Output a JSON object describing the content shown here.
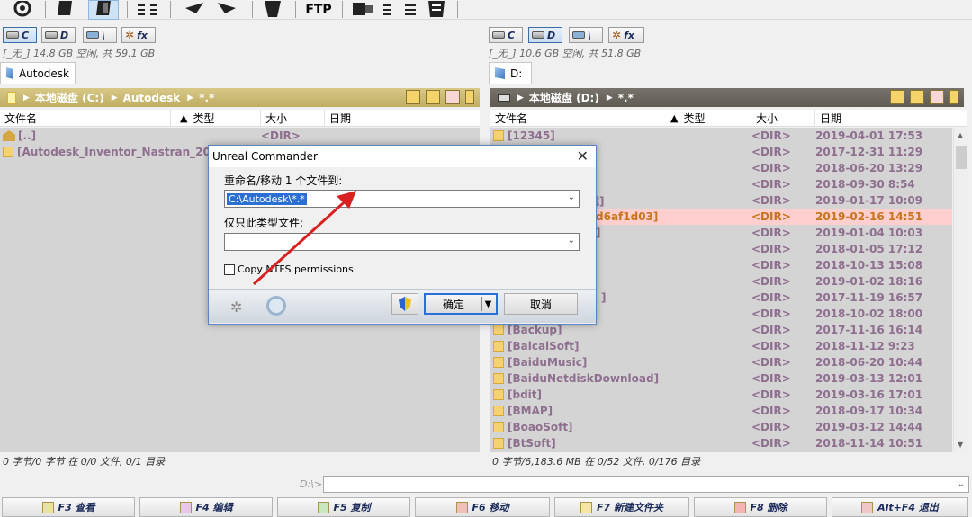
{
  "toolbar": {
    "icons": [
      "refresh-icon",
      "brief-view-icon",
      "full-view-icon",
      "sort-icon",
      "back-icon",
      "forward-icon",
      "multirename-icon",
      "ftp-label",
      "ftp-icon",
      "sync-icon",
      "notepad-icon"
    ],
    "ftp_label": "FTP"
  },
  "left": {
    "drives": [
      {
        "letter": "C",
        "active": true
      },
      {
        "letter": "D",
        "active": false
      },
      {
        "letter": "\\",
        "active": false
      },
      {
        "letter": "fx",
        "active": false
      }
    ],
    "free_info": "[_无_] 14.8 GB 空闲, 共 59.1 GB",
    "tab": "Autodesk",
    "path": [
      "本地磁盘 (C:)",
      "Autodesk",
      "*.*"
    ],
    "columns": [
      "文件名",
      "类型",
      "大小",
      "日期"
    ],
    "rows": [
      {
        "name": "[..]",
        "size": "<DIR>",
        "date": ""
      },
      {
        "name": "[Autodesk_Inventor_Nastran_2020_R",
        "size": "",
        "date": ""
      }
    ],
    "status": "0 字节/0 字节 在 0/0 文件, 0/1 目录"
  },
  "right": {
    "drives": [
      {
        "letter": "C",
        "active": false
      },
      {
        "letter": "D",
        "active": true
      },
      {
        "letter": "\\",
        "active": false
      },
      {
        "letter": "fx",
        "active": false
      }
    ],
    "free_info": "[_无_] 10.6 GB 空闲, 共 51.8 GB",
    "tab": "D:",
    "path": [
      "本地磁盘 (D:)",
      "*.*"
    ],
    "columns": [
      "文件名",
      "类型",
      "大小",
      "日期"
    ],
    "rows": [
      {
        "name": "[12345]",
        "size": "<DIR>",
        "date": "2019-04-01 17:53"
      },
      {
        "name": "",
        "size": "<DIR>",
        "date": "2017-12-31 11:29"
      },
      {
        "name": "",
        "size": "<DIR>",
        "date": "2018-06-20 13:29"
      },
      {
        "name": "",
        "size": "<DIR>",
        "date": "2018-09-30 8:54"
      },
      {
        "name": "载]",
        "size": "<DIR>",
        "date": "2019-01-17 10:09"
      },
      {
        "name": "d6af1d03]",
        "size": "<DIR>",
        "date": "2019-02-16 14:51",
        "selected": true
      },
      {
        "name": "]",
        "size": "<DIR>",
        "date": "2019-01-04 10:03"
      },
      {
        "name": "",
        "size": "<DIR>",
        "date": "2018-01-05 17:12"
      },
      {
        "name": "",
        "size": "<DIR>",
        "date": "2018-10-13 15:08"
      },
      {
        "name": "",
        "size": "<DIR>",
        "date": "2019-01-02 18:16"
      },
      {
        "name": "]",
        "size": "<DIR>",
        "date": "2017-11-19 16:57"
      },
      {
        "name": "",
        "size": "<DIR>",
        "date": "2018-10-02 18:00"
      },
      {
        "name": "[Backup]",
        "size": "<DIR>",
        "date": "2017-11-16 16:14"
      },
      {
        "name": "[BaicaiSoft]",
        "size": "<DIR>",
        "date": "2018-11-12 9:23"
      },
      {
        "name": "[BaiduMusic]",
        "size": "<DIR>",
        "date": "2018-06-20 10:44"
      },
      {
        "name": "[BaiduNetdiskDownload]",
        "size": "<DIR>",
        "date": "2019-03-13 12:01"
      },
      {
        "name": "[bdit]",
        "size": "<DIR>",
        "date": "2019-03-16 17:01"
      },
      {
        "name": "[BMAP]",
        "size": "<DIR>",
        "date": "2018-09-17 10:34"
      },
      {
        "name": "[BoaoSoft]",
        "size": "<DIR>",
        "date": "2019-03-12 14:44"
      },
      {
        "name": "[BtSoft]",
        "size": "<DIR>",
        "date": "2018-11-14 10:51"
      }
    ],
    "status": "0 字节/6,183.6 MB 在 0/52 文件, 0/176 目录"
  },
  "cmdline": {
    "label": "D:\\>",
    "value": ""
  },
  "fkeys": [
    "F3 查看",
    "F4 编辑",
    "F5 复制",
    "F6 移动",
    "F7 新建文件夹",
    "F8 删除",
    "Alt+F4 退出"
  ],
  "dialog": {
    "title": "Unreal Commander",
    "rename_label": "重命名/移动 1 个文件到:",
    "target_value": "C:\\Autodesk\\*.*",
    "filter_label": "仅只此类型文件:",
    "filter_value": "",
    "ntfs_label": "Copy NTFS permissions",
    "ok_label": "确定",
    "cancel_label": "取消"
  },
  "colors": {
    "accent_arrow": "#d92020",
    "selected_row": "#ffcfcf",
    "path_left": "#c9b66d",
    "path_right": "#6b665e"
  }
}
